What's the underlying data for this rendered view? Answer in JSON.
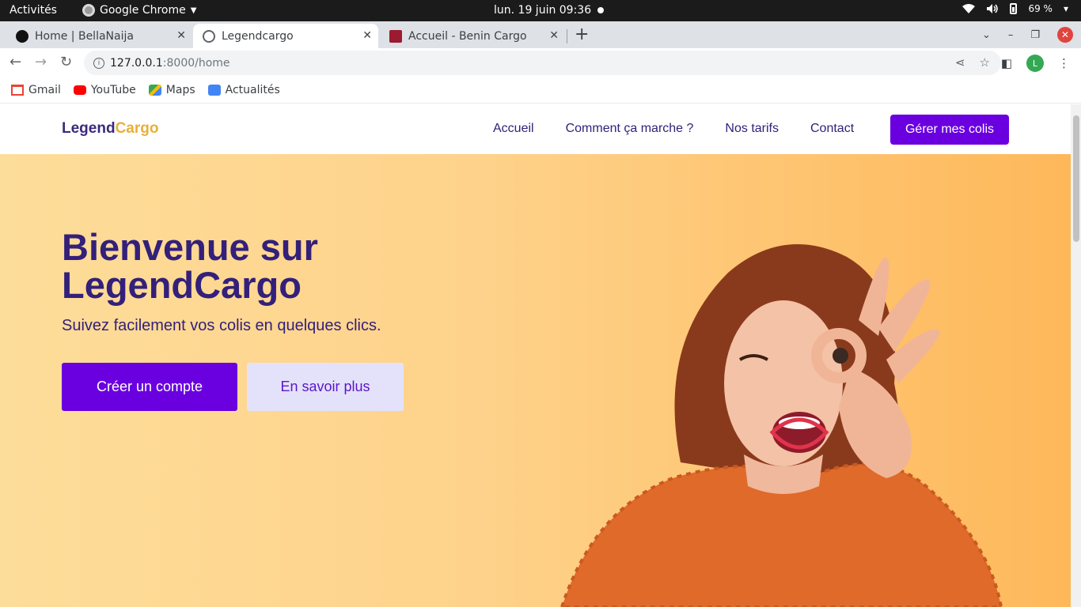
{
  "system_bar": {
    "activities": "Activités",
    "app_name": "Google Chrome",
    "clock": "lun. 19 juin  09:36",
    "battery": "69 %"
  },
  "browser": {
    "tabs": [
      {
        "title": "Home | BellaNaija",
        "favicon": "bellanaija-icon"
      },
      {
        "title": "Legendcargo",
        "favicon": "globe-icon",
        "active": true
      },
      {
        "title": "Accueil - Benin Cargo",
        "favicon": "benin-cargo-icon"
      }
    ],
    "new_tab": "+",
    "url_host": "127.0.0.1",
    "url_path": ":8000/home",
    "profile_initial": "L",
    "bookmarks": [
      {
        "label": "Gmail",
        "icon": "gmail-icon"
      },
      {
        "label": "YouTube",
        "icon": "youtube-icon"
      },
      {
        "label": "Maps",
        "icon": "maps-icon"
      },
      {
        "label": "Actualités",
        "icon": "news-icon"
      }
    ]
  },
  "site": {
    "logo_part1": "Legend",
    "logo_part2": "Cargo",
    "nav": [
      "Accueil",
      "Comment ça marche ?",
      "Nos tarifs",
      "Contact"
    ],
    "nav_cta": "Gérer mes colis",
    "hero": {
      "title_line1": "Bienvenue sur",
      "title_line2": "LegendCargo",
      "subtitle": "Suivez facilement vos colis en quelques clics.",
      "primary_button": "Créer un compte",
      "secondary_button": "En savoir plus"
    }
  },
  "colors": {
    "brand_purple": "#6a00e0",
    "brand_dark": "#33207a",
    "brand_gold": "#e8b03a",
    "hero_gradient_start": "#fddd9a",
    "hero_gradient_end": "#feb85a"
  }
}
